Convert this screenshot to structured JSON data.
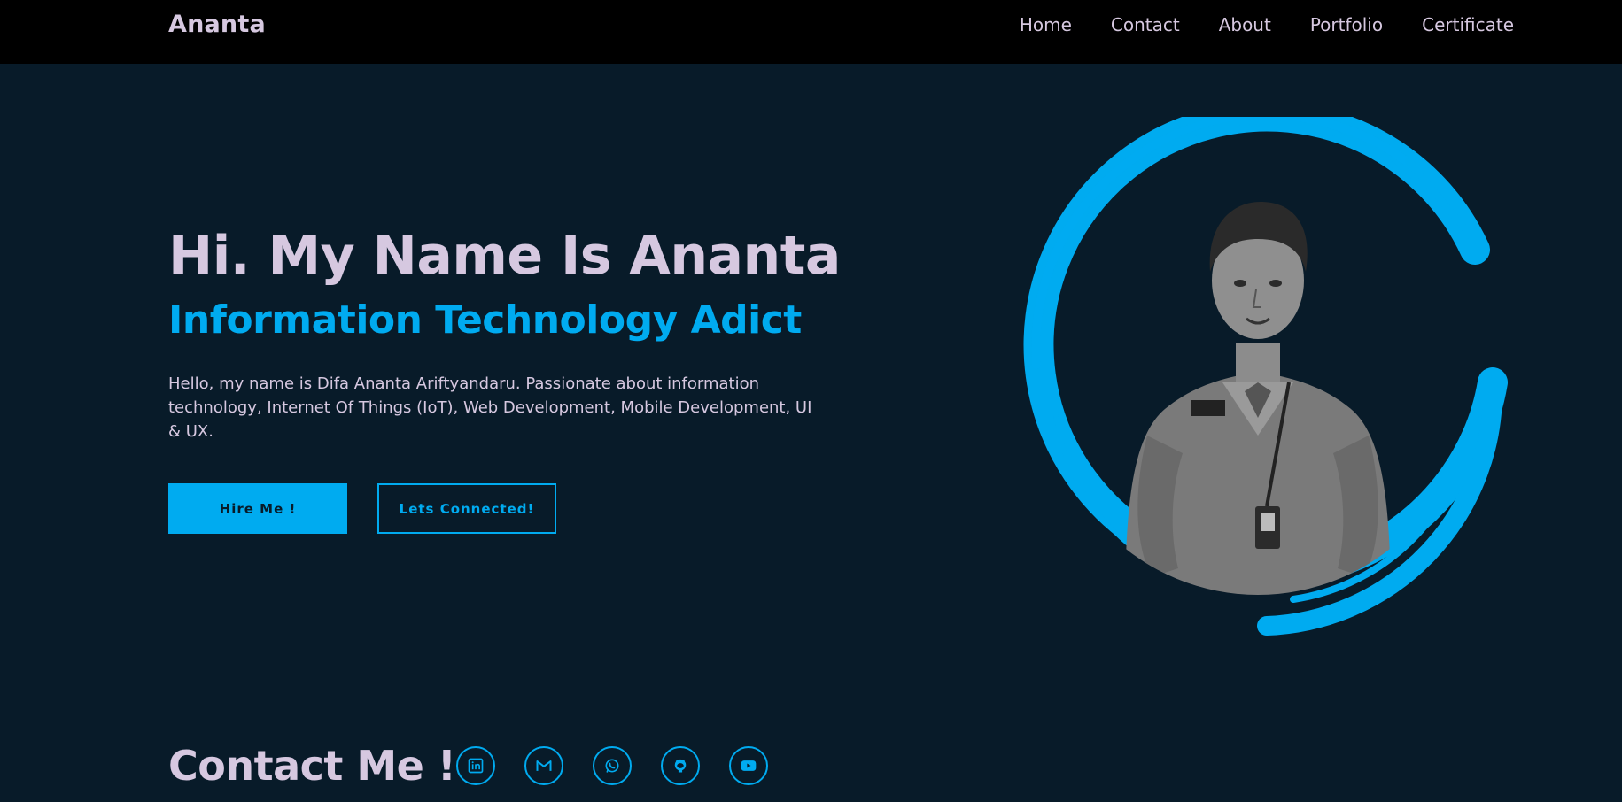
{
  "header": {
    "logo": "Ananta",
    "nav": [
      "Home",
      "Contact",
      "About",
      "Portfolio",
      "Certificate"
    ]
  },
  "hero": {
    "title": "Hi. My Name Is Ananta",
    "subtitle": "Information Technology Adict",
    "description": "Hello, my name is Difa Ananta Ariftyandaru. Passionate about information technology, Internet Of Things (IoT), Web Development, Mobile Development, UI & UX.",
    "hire_button": "Hire Me !",
    "connect_button": "Lets Connected!"
  },
  "contact": {
    "title": "Contact Me !",
    "socials": [
      "linkedin-icon",
      "gmail-icon",
      "whatsapp-icon",
      "github-icon",
      "youtube-icon"
    ]
  },
  "colors": {
    "background": "#081b29",
    "header": "#000000",
    "accent": "#00abf0",
    "text": "#d6c8e0"
  }
}
